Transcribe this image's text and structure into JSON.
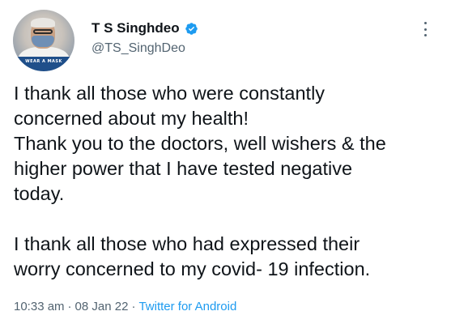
{
  "author": {
    "display_name": "T S Singhdeo",
    "handle": "@TS_SinghDeo",
    "avatar_banner_text": "WEAR A MASK",
    "verified_color": "#1d9bf0"
  },
  "tweet": {
    "lines": [
      "I thank all those who were constantly",
      "concerned about my health!",
      "Thank you to the doctors, well wishers & the",
      "higher power that I have tested negative",
      "today.",
      "",
      "I thank all those who had expressed their",
      "worry concerned to my covid- 19 infection."
    ]
  },
  "meta": {
    "time": "10:33 am",
    "separator": "·",
    "date": "08 Jan 22",
    "source": "Twitter for Android"
  },
  "colors": {
    "text": "#0f1419",
    "secondary": "#536471",
    "link": "#1d9bf0"
  },
  "icons": {
    "verified": "verified-badge-icon",
    "more": "more-vertical-icon"
  }
}
